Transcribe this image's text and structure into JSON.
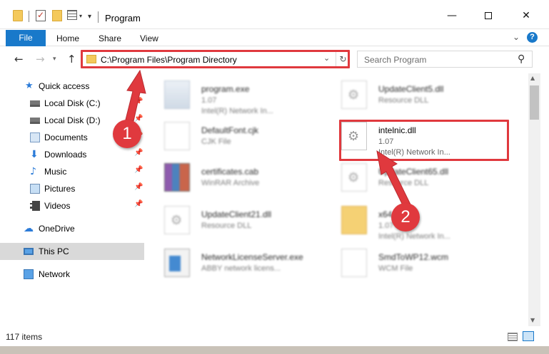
{
  "window": {
    "title": "Program",
    "minimize_glyph": "—",
    "close_glyph": "✕"
  },
  "ribbon": {
    "tabs": [
      {
        "label": "File"
      },
      {
        "label": "Home"
      },
      {
        "label": "Share"
      },
      {
        "label": "View"
      }
    ],
    "help_glyph": "?"
  },
  "address": {
    "path": "C:\\Program Files\\Program Directory"
  },
  "search": {
    "placeholder": "Search Program"
  },
  "sidebar": {
    "items": [
      {
        "label": "Quick access",
        "icon": "star-icon",
        "pinned": false
      },
      {
        "label": "Local Disk (C:)",
        "icon": "drive-icon",
        "pinned": true
      },
      {
        "label": "Local Disk (D:)",
        "icon": "drive-icon",
        "pinned": true
      },
      {
        "label": "Documents",
        "icon": "documents-icon",
        "pinned": true
      },
      {
        "label": "Downloads",
        "icon": "download-icon",
        "pinned": true
      },
      {
        "label": "Music",
        "icon": "music-icon",
        "pinned": true
      },
      {
        "label": "Pictures",
        "icon": "pictures-icon",
        "pinned": true
      },
      {
        "label": "Videos",
        "icon": "videos-icon",
        "pinned": true
      },
      {
        "label": "OneDrive",
        "icon": "cloud-icon",
        "pinned": false
      },
      {
        "label": "This PC",
        "icon": "computer-icon",
        "pinned": false,
        "selected": true
      },
      {
        "label": "Network",
        "icon": "network-icon",
        "pinned": false
      }
    ]
  },
  "files": [
    {
      "name": "program.exe",
      "line1": "1.07",
      "line2": "Intel(R) Network In...",
      "icon": "exe-icon",
      "blurred": true
    },
    {
      "name": "UpdateClient5.dll",
      "line1": "Resource DLL",
      "line2": "",
      "icon": "dll-icon",
      "blurred": true
    },
    {
      "name": "DefaultFont.cjk",
      "line1": "CJK File",
      "line2": "",
      "icon": "document-icon",
      "blurred": true
    },
    {
      "name": "intelnic.dll",
      "line1": "1.07",
      "line2": "Intel(R) Network In...",
      "icon": "dll-icon",
      "blurred": false
    },
    {
      "name": "certificates.cab",
      "line1": "WinRAR Archive",
      "line2": "",
      "icon": "archive-icon",
      "blurred": true
    },
    {
      "name": "UpdateClient65.dll",
      "line1": "Resource DLL",
      "line2": "",
      "icon": "dll-icon",
      "blurred": true
    },
    {
      "name": "UpdateClient21.dll",
      "line1": "Resource DLL",
      "line2": "",
      "icon": "dll-icon",
      "blurred": true
    },
    {
      "name": "x64",
      "line1": "1.07",
      "line2": "Intel(R) Network In...",
      "icon": "folder-icon",
      "blurred": true
    },
    {
      "name": "NetworkLicenseServer.exe",
      "line1": "ABBY network licens...",
      "line2": "",
      "icon": "app-icon",
      "blurred": true
    },
    {
      "name": "SmdToWP12.wcm",
      "line1": "WCM File",
      "line2": "",
      "icon": "document-icon",
      "blurred": true
    }
  ],
  "status": {
    "items_text": "117 items"
  },
  "annotations": {
    "step1": "1",
    "step2": "2",
    "color": "#e0393e"
  }
}
